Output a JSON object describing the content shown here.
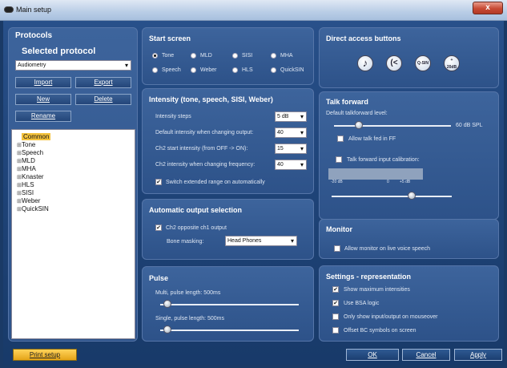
{
  "window": {
    "title": "Main setup",
    "close_label": "x"
  },
  "protocols": {
    "title": "Protocols",
    "selected_title": "Selected protocol",
    "selected_value": "Audiometry",
    "buttons": {
      "import": "Import",
      "export": "Export",
      "new": "New",
      "delete": "Delete",
      "rename": "Rename"
    },
    "tree": [
      {
        "label": "Common",
        "expander": ""
      },
      {
        "label": "Tone",
        "expander": "⊞"
      },
      {
        "label": "Speech",
        "expander": "⊞"
      },
      {
        "label": "MLD",
        "expander": "⊞"
      },
      {
        "label": "MHA",
        "expander": "⊞"
      },
      {
        "label": "Knaster",
        "expander": "⊞"
      },
      {
        "label": "HLS",
        "expander": "⊞"
      },
      {
        "label": "SISI",
        "expander": "⊞"
      },
      {
        "label": "Weber",
        "expander": "⊞"
      },
      {
        "label": "QuickSIN",
        "expander": "⊞"
      }
    ]
  },
  "start_screen": {
    "title": "Start screen",
    "options": [
      {
        "label": "Tone",
        "selected": true
      },
      {
        "label": "MLD",
        "selected": false
      },
      {
        "label": "SISI",
        "selected": false
      },
      {
        "label": "MHA",
        "selected": false
      },
      {
        "label": "Speech",
        "selected": false
      },
      {
        "label": "Weber",
        "selected": false
      },
      {
        "label": "HLS",
        "selected": false
      },
      {
        "label": "QuickSIN",
        "selected": false
      }
    ]
  },
  "intensity": {
    "title": "Intensity (tone, speech, SISI, Weber)",
    "steps_label": "Intensity steps",
    "steps_value": "5 dB",
    "default_label": "Default intensity when changing output:",
    "default_value": "40",
    "ch2_start_label": "Ch2 start intensity (from OFF -> ON):",
    "ch2_start_value": "15",
    "ch2_freq_label": "Ch2 intensity when changing frequency:",
    "ch2_freq_value": "40",
    "extended_label": "Switch extended range on automatically",
    "extended_checked": true
  },
  "auto_output": {
    "title": "Automatic output selection",
    "ch2_label": "Ch2 opposite ch1 output",
    "ch2_checked": true,
    "bone_label": "Bone masking:",
    "bone_value": "Head Phones"
  },
  "pulse": {
    "title": "Pulse",
    "multi_label": "Multi, pulse length: 500ms",
    "single_label": "Single, pulse length: 500ms"
  },
  "direct_access": {
    "title": "Direct access buttons",
    "icons": [
      "music-note",
      "ear",
      "Q-SIN",
      "+20dB"
    ],
    "qsin_text": "Q-SIN",
    "db_text": "20dB"
  },
  "talk_forward": {
    "title": "Talk forward",
    "default_label": "Default talkforward level:",
    "level_value": "60 dB SPL",
    "fed_in_ff_label": "Allow talk fed in FF",
    "input_cal_label": "Talk forward input calibration:",
    "meter_low": "-20 dB",
    "meter_zero": "0",
    "meter_high": "+5 dB"
  },
  "monitor": {
    "title": "Monitor",
    "live_voice_label": "Allow monitor on live voice speech"
  },
  "settings": {
    "title": "Settings - representation",
    "items": [
      {
        "label": "Show maximum intensities",
        "checked": true
      },
      {
        "label": "Use BSA logic",
        "checked": true
      },
      {
        "label": "Only show input/output on mouseover",
        "checked": false
      },
      {
        "label": "Offset BC symbols on screen",
        "checked": false
      }
    ]
  },
  "footer": {
    "print": "Print setup",
    "ok": "OK",
    "cancel": "Cancel",
    "apply": "Apply"
  },
  "colors": {
    "background": "#1f4479",
    "panel": "#3d649c",
    "print_button": "#f0b830"
  }
}
